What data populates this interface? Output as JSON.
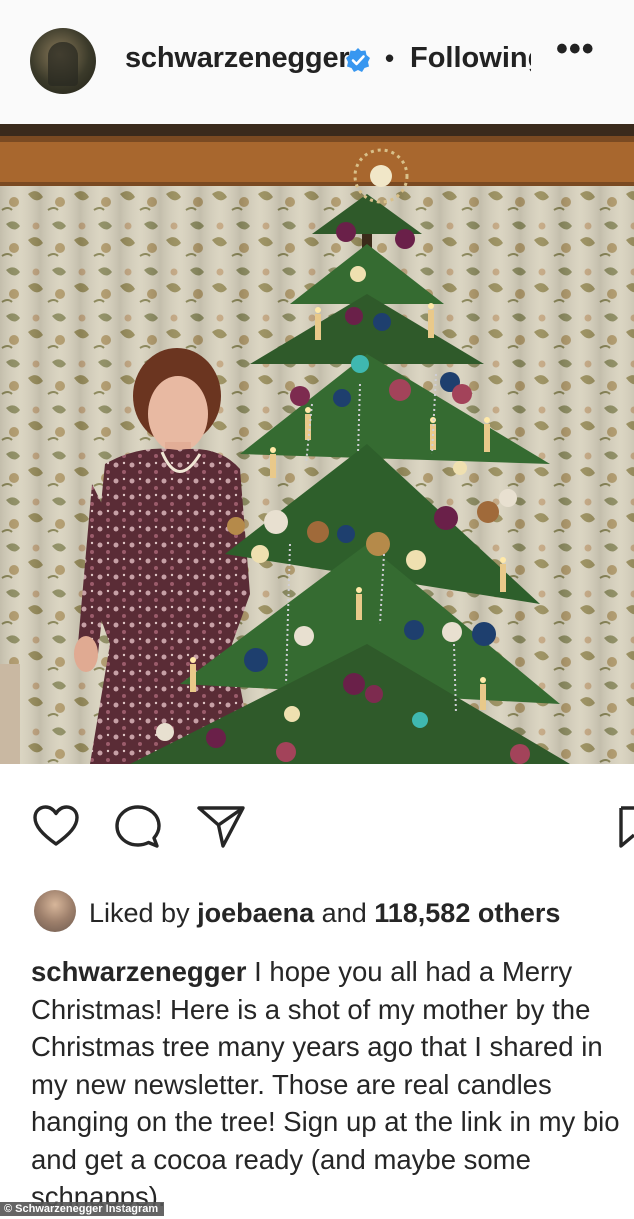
{
  "post": {
    "username": "schwarzenegger",
    "separator": "•",
    "follow_status": "Following",
    "more_label": "•••",
    "verified": true
  },
  "actions": {
    "like_icon": "heart-icon",
    "comment_icon": "comment-icon",
    "share_icon": "send-icon",
    "save_icon": "bookmark-icon"
  },
  "likes": {
    "prefix": "Liked by",
    "user": "joebaena",
    "middle": "and",
    "count_text": "118,582 others"
  },
  "caption": {
    "username": "schwarzenegger",
    "text": "I hope you all had a Merry Christmas! Here is a shot of my mother by the Christmas tree many years ago that I shared in my new newsletter. Those are real candles hanging on the tree! Sign up at the link in my bio and get a cocoa ready (and maybe some schnapps)."
  },
  "credit": "© Schwarzenegger Instagram",
  "colors": {
    "verified_blue": "#3897f0",
    "text": "#262626",
    "tree_green": "#2f5a2a"
  }
}
